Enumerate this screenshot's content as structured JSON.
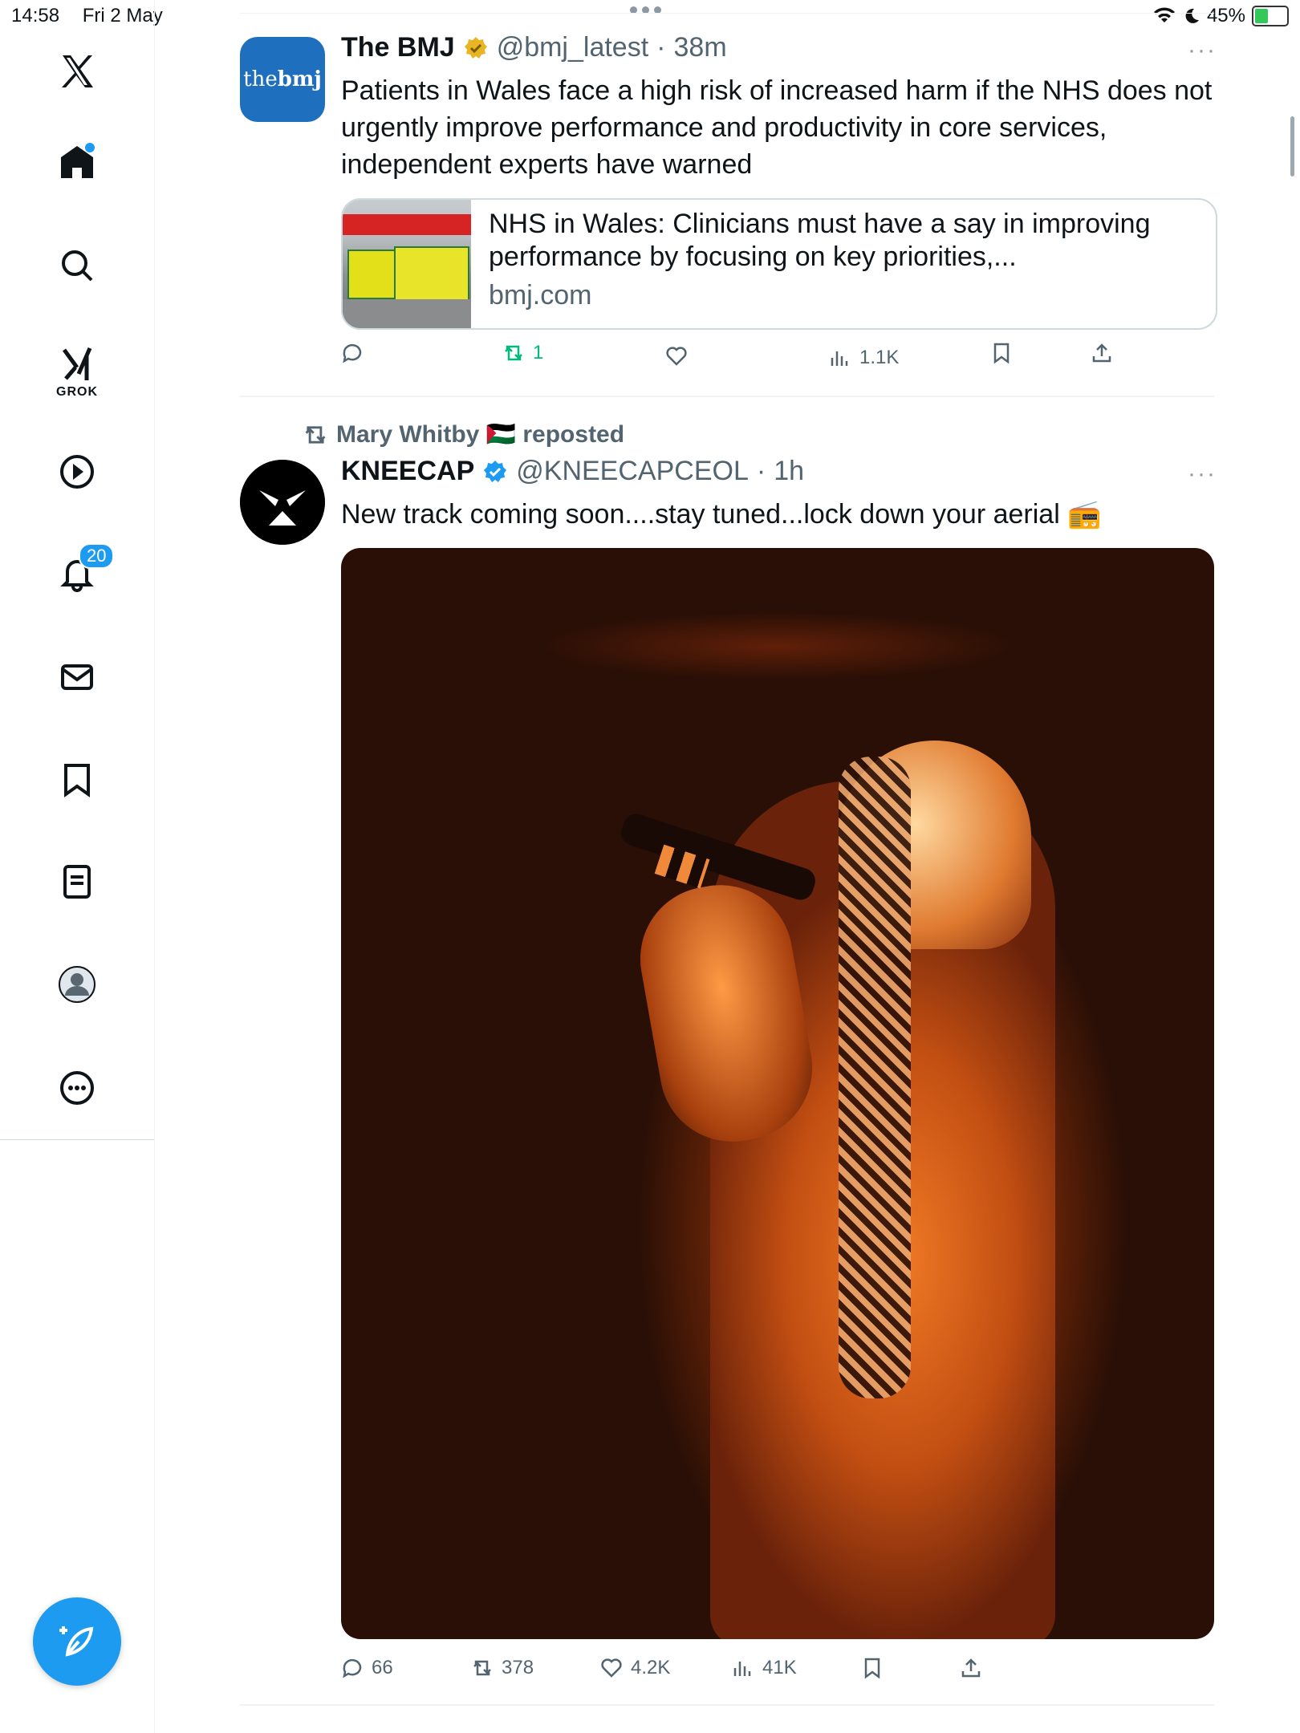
{
  "status_bar": {
    "time": "14:58",
    "date": "Fri 2 May",
    "battery": "45%"
  },
  "nav": {
    "notifications_badge": "20",
    "grok_label": "GROK"
  },
  "tweets": [
    {
      "avatar_text_a": "the",
      "avatar_text_b": "bmj",
      "name": "The BMJ",
      "handle": "@bmj_latest",
      "sep": "·",
      "time": "38m",
      "text": "Patients in Wales face a high risk of increased harm if the NHS does not urgently improve performance and productivity in core services, independent experts have warned",
      "card": {
        "title": "NHS in Wales: Clinicians must have a say in improving performance by focusing on key priorities,...",
        "domain": "bmj.com"
      },
      "stats": {
        "replies": "",
        "reposts": "1",
        "likes": "",
        "views": "1.1K"
      }
    },
    {
      "reposted_by": "Mary Whitby 🇵🇸 reposted",
      "name": "KNEECAP",
      "handle": "@KNEECAPCEOL",
      "sep": "·",
      "time": "1h",
      "text": "New track coming soon....stay tuned...lock down your aerial 📻",
      "stats": {
        "replies": "66",
        "reposts": "378",
        "likes": "4.2K",
        "views": "41K"
      }
    }
  ],
  "colors": {
    "accent": "#1d9bf0",
    "repost_green": "#00ba7c",
    "muted": "#536471"
  }
}
